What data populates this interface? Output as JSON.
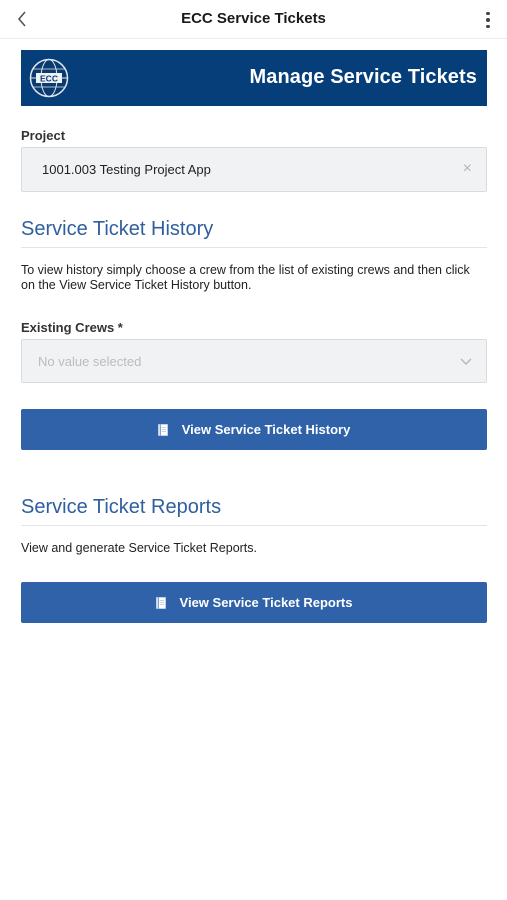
{
  "header": {
    "title": "ECC Service Tickets",
    "back_icon": "chevron-left-icon",
    "menu_icon": "kebab-menu-icon"
  },
  "banner": {
    "title": "Manage Service Tickets",
    "logo_text": "ECC",
    "background_color": "#063e79"
  },
  "project": {
    "label": "Project",
    "value": "1001.003 Testing Project App",
    "clear_icon": "close-icon"
  },
  "history": {
    "title": "Service Ticket History",
    "description": "To view history simply choose a crew from the list of existing crews and then click on the View Service Ticket History button.",
    "crews_label": "Existing Crews *",
    "crews_placeholder": "No value selected",
    "button_label": "View Service Ticket History",
    "button_icon": "notebook-icon"
  },
  "reports": {
    "title": "Service Ticket Reports",
    "description": "View and generate Service Ticket Reports.",
    "button_label": "View Service Ticket Reports",
    "button_icon": "notebook-icon"
  },
  "colors": {
    "accent": "#2f62a8",
    "section_title": "#2f5f9e"
  }
}
